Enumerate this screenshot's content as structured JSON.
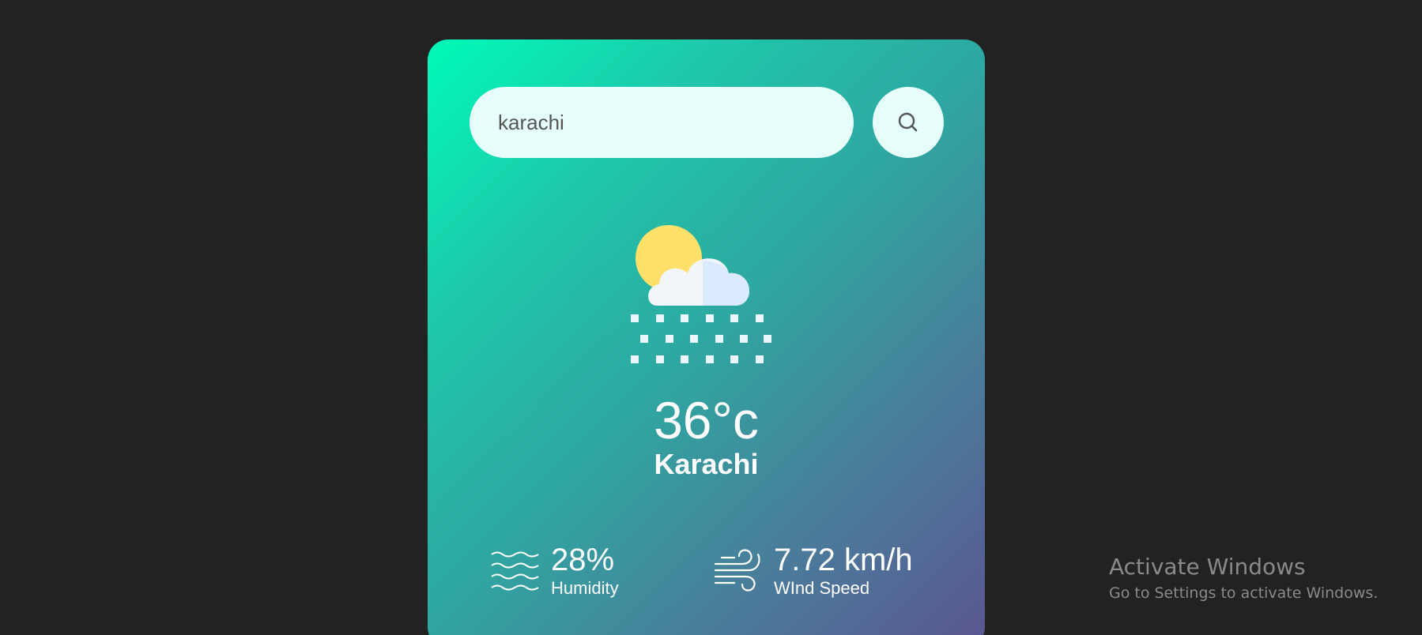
{
  "search": {
    "value": "karachi",
    "placeholder": "",
    "button_icon": "search-icon"
  },
  "weather": {
    "icon": "snow-sun-cloud-icon",
    "temperature": "36°c",
    "city": "Karachi"
  },
  "details": {
    "humidity": {
      "icon": "humidity-waves-icon",
      "value": "28%",
      "label": "Humidity"
    },
    "wind": {
      "icon": "wind-icon",
      "value": "7.72 km/h",
      "label": "WInd Speed"
    }
  },
  "watermark": {
    "title": "Activate Windows",
    "subtitle": "Go to Settings to activate Windows."
  },
  "colors": {
    "background": "#222222",
    "gradient_start": "#00fbba",
    "gradient_end": "#5b5591",
    "input_bg": "#e6fffb",
    "text": "#ffffff"
  }
}
